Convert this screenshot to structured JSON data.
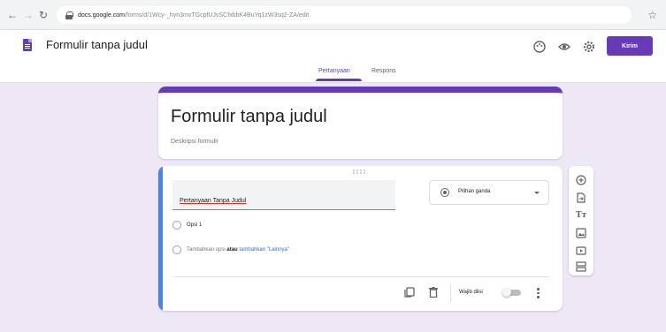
{
  "browser": {
    "back_icon": "back-arrow-icon",
    "forward_icon": "forward-arrow-icon",
    "reload_icon": "reload-icon",
    "url_domain": "docs.google.com",
    "url_path": "/forms/d/1Wcy-_hyn3mvTGcpfUJvSCfxbbK4BuYq1zW3sq2-ZA/edit"
  },
  "header": {
    "doc_title": "Formulir tanpa judul",
    "send_label": "Kirim",
    "icons": [
      "palette-icon",
      "eye-icon",
      "settings-icon"
    ]
  },
  "tabs": {
    "questions": "Pertanyaan",
    "responses": "Respons"
  },
  "form": {
    "title": "Formulir tanpa judul",
    "description_placeholder": "Deskripsi formulir"
  },
  "question": {
    "title": "Pertanyaan Tanpa Judul",
    "type": "Pilihan ganda",
    "option_1": "Opsi 1",
    "add_option": "Tambahkan opsi",
    "or": "atau",
    "add_other": "tambahkan \"Lainnya\"",
    "required_label": "Wajib diisi",
    "required": false
  },
  "toolbar": {
    "title_glyph": "Tт",
    "items": [
      "add-question-icon",
      "import-questions-icon",
      "add-title-icon",
      "add-image-icon",
      "add-video-icon",
      "add-section-icon"
    ]
  },
  "colors": {
    "accent": "#673ab7",
    "canvas": "#ede7f6",
    "active_bar": "#4285f4",
    "link": "#1a73e8"
  }
}
